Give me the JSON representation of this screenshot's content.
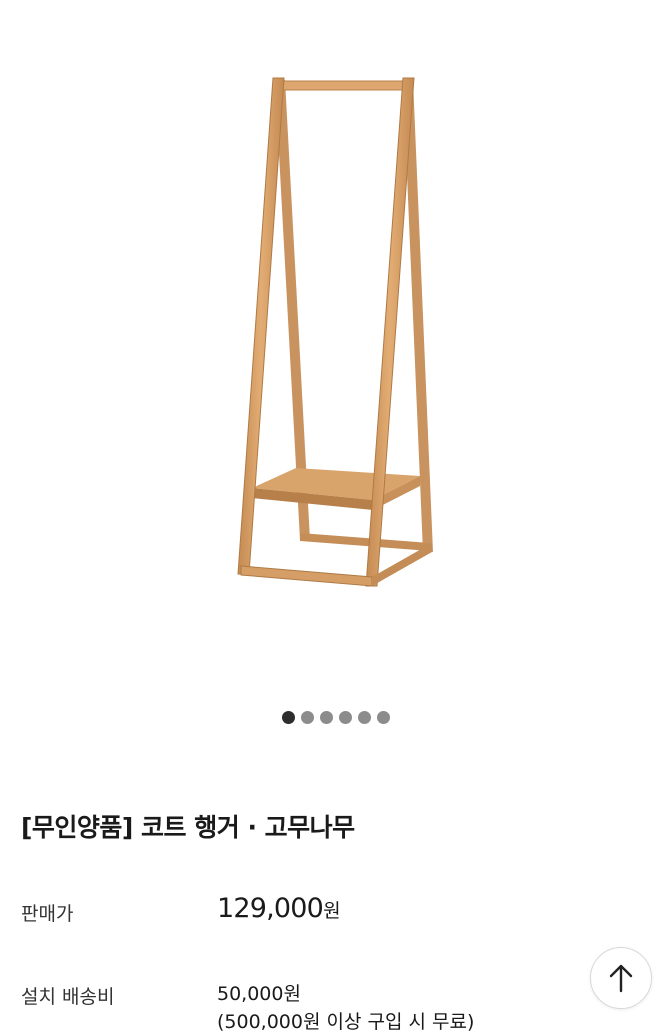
{
  "gallery": {
    "slide_count": 6,
    "active_index": 0
  },
  "product": {
    "title": "[무인양품] 코트 행거 · 고무나무",
    "price_label": "판매가",
    "price_value": "129,000",
    "price_unit": "원",
    "shipping_label": "설치 배송비",
    "shipping_fee": "50,000원",
    "shipping_note": "(500,000원 이상 구입 시 무료)"
  },
  "icons": {
    "scroll_top": "arrow-up-icon"
  },
  "colors": {
    "wood": "#d7a26a",
    "wood_dark": "#b9834c",
    "dot_active": "#2e2e2e",
    "dot_inactive": "#8c8c8c"
  }
}
